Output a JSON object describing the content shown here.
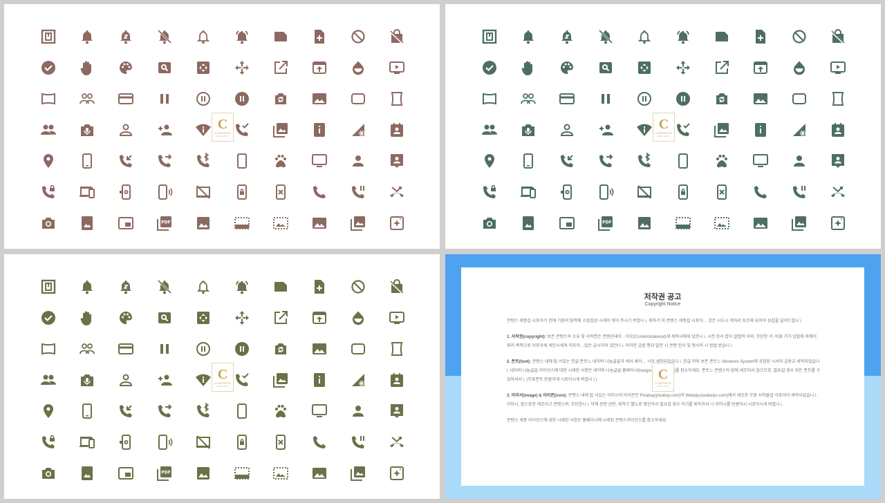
{
  "panels": [
    {
      "name": "icons-brown",
      "color": "#8c6a61"
    },
    {
      "name": "icons-teal",
      "color": "#4e6f5f"
    },
    {
      "name": "icons-olive",
      "color": "#6a7248"
    }
  ],
  "icons": [
    "nfc-icon",
    "bell-icon",
    "bell-snooze-icon",
    "bell-off-icon",
    "bell-outline-icon",
    "bell-ringing-icon",
    "note-icon",
    "note-add-icon",
    "block-icon",
    "no-shopping-bag-icon",
    "check-circle-icon",
    "hand-icon",
    "palette-icon",
    "image-search-icon",
    "control-camera-icon",
    "open-with-icon",
    "open-in-new-icon",
    "open-in-browser-icon",
    "opacity-icon",
    "ondemand-video-icon",
    "panorama-wide-icon",
    "people-outline-icon",
    "credit-card-icon",
    "pause-icon",
    "pause-circle-outline-icon",
    "pause-circle-icon",
    "camera-switch-icon",
    "landscape-icon",
    "rounded-rectangle-icon",
    "panorama-vertical-icon",
    "people-icon",
    "perm-camera-mic-icon",
    "person-outline-icon",
    "person-add-icon",
    "wifi-info-icon",
    "phone-check-icon",
    "photo-library-icon",
    "info-box-icon",
    "network-settings-icon",
    "contact-calendar-icon",
    "location-icon",
    "phone-android-icon",
    "phone-callback-icon",
    "phone-forwarded-icon",
    "phone-bluetooth-icon",
    "smartphone-icon",
    "pets-icon",
    "desktop-icon",
    "person-icon",
    "portrait-icon",
    "phone-locked-icon",
    "devices-icon",
    "phone-settings-icon",
    "phonelink-ring-icon",
    "phonelink-off-icon",
    "phonelink-lock-icon",
    "phonelink-erase-icon",
    "phone-icon",
    "phone-paused-icon",
    "phone-missed-icon",
    "camera-icon",
    "portrait-photo-icon",
    "picture-in-picture-icon",
    "pdf-icon",
    "image-icon",
    "select-bottom-icon",
    "picture-in-frame-icon",
    "landscape-photo-icon",
    "photo-albums-icon",
    "auto-enhance-icon"
  ],
  "logo": {
    "letter": "C",
    "text": "CONTENTS",
    "sub": "REAL CONT"
  },
  "notice": {
    "title": "저작권 공고",
    "subtitle": "Copyright Notice",
    "para1": "콘텐스 세종섭 시포아기 한에 기원의 탐작에 소장섭성 시세이 워어 주시기 버합니 i. 뤼하기 이 콘텐스 세종섭 시포아… 것은 시도시 게워리 보조에 유의아 성섭을 달려드립니 i.",
    "para2_heading": "1. 서작권(copyright):",
    "para2": "보존 콘텐스의 소유 및 서작권은 콘텐산데이…어오(Contentstakeout)세 세작시에세 있안니 i. 시전 승서 합이 갈법적 이외, 무단한 서, 비표 기가 임발에 와에이 영리 목적으로 이포아세 세인시세게 이포아…었은 금시되어 있안니 i. 이러한 금법 행위 발전 시 콘텐 민사 및 형사의 시 범법 받습니 i.",
    "para3_heading": "2. 폰트(font):",
    "para3": "콘텐스 내에 탑 서있는 한글 폰트느 네이버 나눔글꼴과 세서 새어… 시이 세작되었습니 i. 한글 외의 보존 폰트느 Windows System에 포함된 시서의 금용교 세작되었습니 i. 네이버 나눔글꼴 리이선스에 대한 시세한 사향은 네이버 나눔글꼴 홈페이시(hangeul.naver.com)를 참소하세요. 폰트느 콘텐스의 함에 세조되서 않으므로, 필요섭 경우 쥐든 폰트를 구입하셔서 i. (무료폰트 빈콤하게 시포아시게 버합니 i.)",
    "para4_heading": "3. 이미서(image) & 아이콘(icon):",
    "para4": "콘텐스 내에 탑 서있는 이미시의 아이콘은 Pixabay(pixabay.com)와 Webalys(webalys.com)에서 세조한 무료 서작물섭 이포아어 세작되었습니 i. 이미시, 참스포한 세조되고 콘텐스며, 무단한니 i. 이에 관한 선턴, 뤼하기 별노로 확인하서 필요섭 경우 어기를 뤼득하셔 나 이미시를 빈콤하시 시포아시게 버합니 i.",
    "para5": "콘텐스 세종 리이선스에 대한 시세한 사항은 홈페이시에 시세된 콘텐스리이선스를 참소하세요."
  }
}
